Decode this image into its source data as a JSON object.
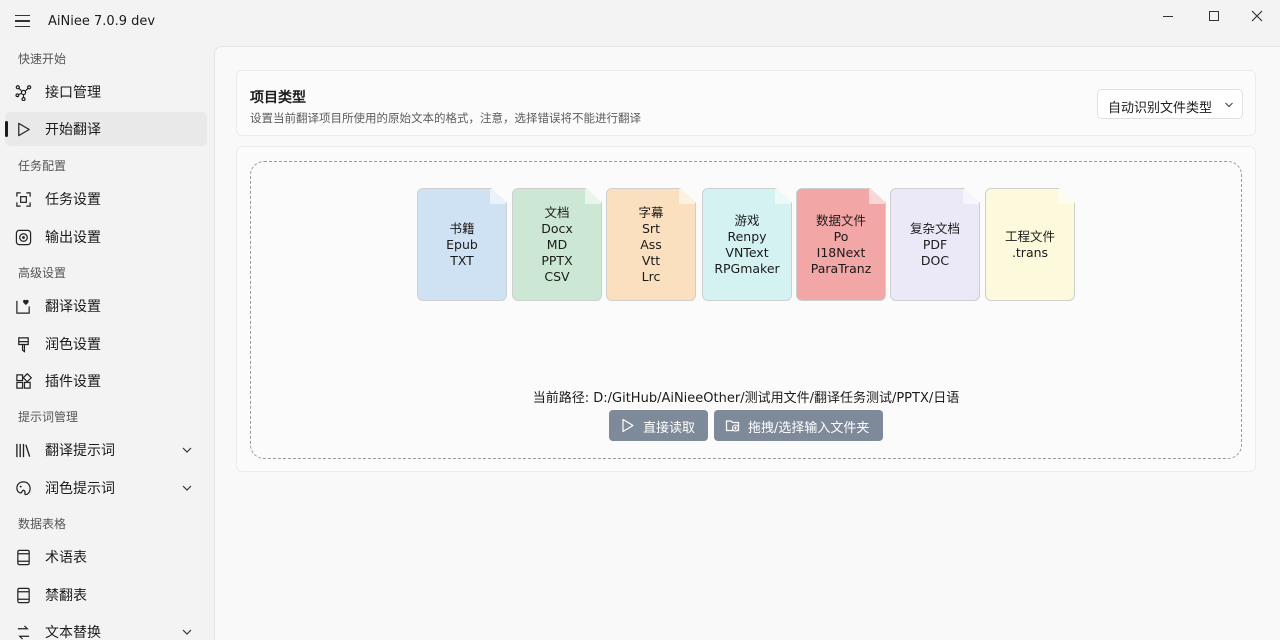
{
  "app": {
    "title": "AiNiee 7.0.9 dev"
  },
  "sidebar": {
    "sections": [
      {
        "title": "快速开始"
      },
      {
        "title": "任务配置"
      },
      {
        "title": "高级设置"
      },
      {
        "title": "提示词管理"
      },
      {
        "title": "数据表格"
      }
    ],
    "items": [
      {
        "label": "接口管理",
        "icon": "network-icon"
      },
      {
        "label": "开始翻译",
        "icon": "play-icon",
        "active": true
      },
      {
        "label": "任务设置",
        "icon": "task-settings-icon"
      },
      {
        "label": "输出设置",
        "icon": "output-icon"
      },
      {
        "label": "翻译设置",
        "icon": "translate-settings-icon"
      },
      {
        "label": "润色设置",
        "icon": "brush-icon"
      },
      {
        "label": "插件设置",
        "icon": "plugin-icon"
      },
      {
        "label": "翻译提示词",
        "icon": "library-icon",
        "expandable": true
      },
      {
        "label": "润色提示词",
        "icon": "palette-icon",
        "expandable": true
      },
      {
        "label": "术语表",
        "icon": "book-icon"
      },
      {
        "label": "禁翻表",
        "icon": "ban-book-icon"
      },
      {
        "label": "文本替换",
        "icon": "replace-icon",
        "expandable": true
      }
    ]
  },
  "project_type": {
    "title": "项目类型",
    "description": "设置当前翻译项目所使用的原始文本的格式，注意，选择错误将不能进行翻译",
    "selected": "自动识别文件类型"
  },
  "file_types": [
    {
      "lines": [
        "书籍",
        "Epub",
        "TXT"
      ],
      "color": "#cfe2f3"
    },
    {
      "lines": [
        "文档",
        "Docx",
        "MD",
        "PPTX",
        "CSV"
      ],
      "color": "#cce8d4"
    },
    {
      "lines": [
        "字幕",
        "Srt",
        "Ass",
        "Vtt",
        "Lrc"
      ],
      "color": "#fbe0bf"
    },
    {
      "lines": [
        "游戏",
        "Renpy",
        "VNText",
        "RPGmaker"
      ],
      "color": "#d4f2f2"
    },
    {
      "lines": [
        "数据文件",
        "Po",
        "I18Next",
        "ParaTranz"
      ],
      "color": "#f2a6a6"
    },
    {
      "lines": [
        "复杂文档",
        "PDF",
        "DOC"
      ],
      "color": "#ebe9f7"
    },
    {
      "lines": [
        "工程文件",
        ".trans"
      ],
      "color": "#fdf9dc"
    }
  ],
  "current_path": "当前路径: D:/GitHub/AiNieeOther/测试用文件/翻译任务测试/PPTX/日语",
  "buttons": {
    "read": "直接读取",
    "drag": "拖拽/选择输入文件夹"
  }
}
